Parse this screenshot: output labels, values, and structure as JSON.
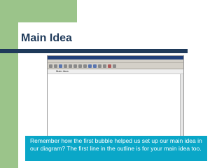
{
  "slide": {
    "title": "Main Idea",
    "caption": "Remember how the first bubble helped us set up our main idea in our diagram? The first line in the outline is for your main idea too."
  },
  "app": {
    "title": "",
    "outline_first_line": "Main Idea",
    "toolbar_icons": [
      "new-icon",
      "open-icon",
      "save-icon",
      "print-icon",
      "cut-icon",
      "copy-icon",
      "paste-icon",
      "undo-icon",
      "add-topic-icon",
      "add-subtopic-icon",
      "link-icon",
      "note-icon",
      "color-icon",
      "zoom-icon"
    ]
  },
  "colors": {
    "accent_green": "#9bc48a",
    "title_navy": "#1f3a5a",
    "caption_bg": "#0aa7c8"
  }
}
